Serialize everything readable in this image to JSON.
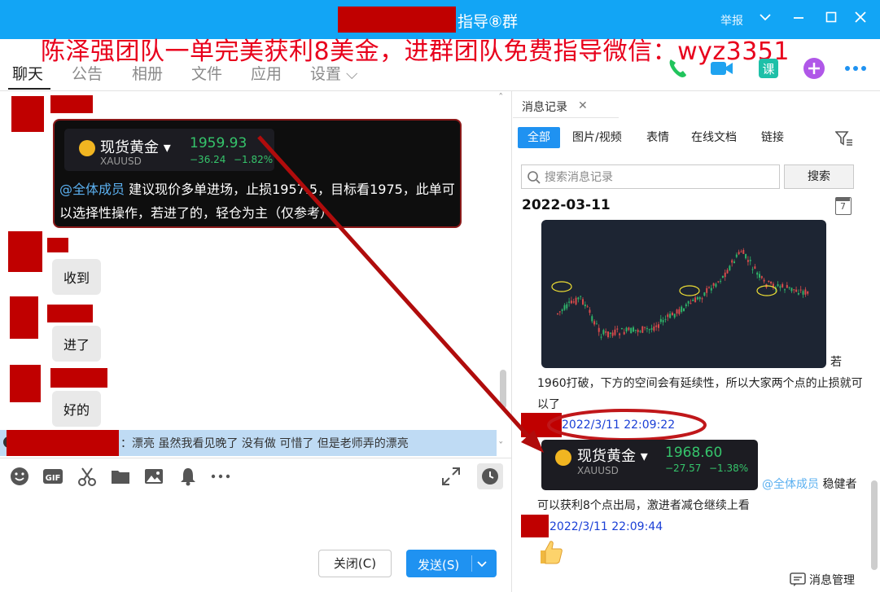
{
  "window": {
    "title": "指导⑧群",
    "report_label": "举报"
  },
  "promo_overlay": "陈泽强团队一单完美获利8美金，进群团队免费指导微信：wyz3351",
  "tabs": [
    {
      "label": "聊天",
      "active": true
    },
    {
      "label": "公告"
    },
    {
      "label": "相册"
    },
    {
      "label": "文件"
    },
    {
      "label": "应用"
    },
    {
      "label": "设置 ⌵"
    }
  ],
  "chat": {
    "quote": {
      "name": "现货黄金",
      "symbol": "XAUUSD",
      "price": "1959.93",
      "change": "−36.24",
      "change_pct": "−1.82%"
    },
    "signal_mention": "@全体成员",
    "signal_text": " 建议现价多单进场，止损1957.5，目标看1975，此单可以选择性操作，若进了的，轻仓为主（仅参考）",
    "replies": [
      "收到",
      "进了",
      "好的"
    ],
    "notice": "：漂亮 虽然我看见晚了 没有做  可惜了 但是老师弄的漂亮"
  },
  "buttons": {
    "close": "关闭(C)",
    "send": "发送(S)"
  },
  "history": {
    "title": "消息记录",
    "filters": [
      "全部",
      "图片/视频",
      "表情",
      "在线文档",
      "链接"
    ],
    "search_placeholder": "搜索消息记录",
    "search_button": "搜索",
    "date": "2022-03-11",
    "calendar_day": "7",
    "msg1_tail": "若",
    "msg1_text": "1960打破，下方的空间会有延续性，所以大家两个点的止损就可以了",
    "ts1": "2022/3/11 22:09:22",
    "quote": {
      "name": "现货黄金",
      "symbol": "XAUUSD",
      "price": "1968.60",
      "change": "−27.57",
      "change_pct": "−1.38%"
    },
    "msg2_mention": "@全体成员",
    "msg2_head": " 稳健者",
    "msg2_text": "可以获利8个点出局，激进者减仓继续上看",
    "ts2": "2022/3/11 22:09:44",
    "manage": "消息管理"
  },
  "colors": {
    "titlebar": "#12a5f5",
    "accent": "#1f92f1",
    "redaction": "#c00000",
    "promo": "#e8001c",
    "price_up": "#35c46b"
  }
}
